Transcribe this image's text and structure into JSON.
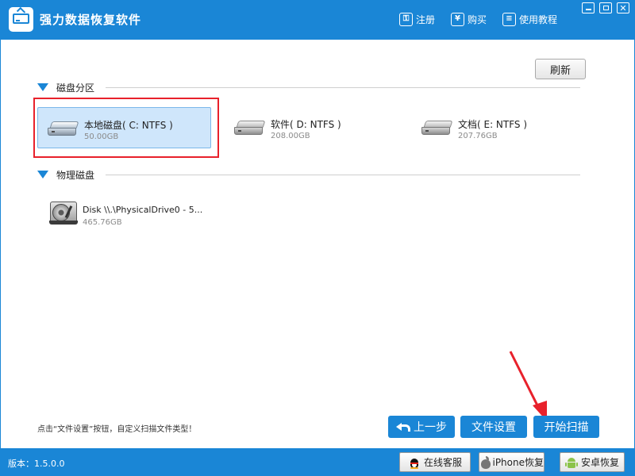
{
  "app": {
    "title": "强力数据恢复软件"
  },
  "header": {
    "register_label": "注册",
    "buy_label": "购买",
    "help_label": "使用教程"
  },
  "toolbar": {
    "refresh_label": "刷新"
  },
  "partitions": {
    "section_label": "磁盘分区",
    "items": [
      {
        "name": "本地磁盘( C: NTFS )",
        "size": "50.00GB",
        "selected": true
      },
      {
        "name": "软件( D: NTFS )",
        "size": "208.00GB",
        "selected": false
      },
      {
        "name": "文档( E: NTFS )",
        "size": "207.76GB",
        "selected": false
      }
    ]
  },
  "physical": {
    "section_label": "物理磁盘",
    "items": [
      {
        "name": "Disk \\\\.\\PhysicalDrive0 - 5...",
        "size": "465.76GB"
      }
    ]
  },
  "hint_text": "点击“文件设置”按钮，自定义扫描文件类型！",
  "actions": {
    "prev_label": "上一步",
    "settings_label": "文件设置",
    "scan_label": "开始扫描"
  },
  "status": {
    "version_text": "版本：1.5.0.0",
    "qq_label": "在线客服",
    "iphone_label": "iPhone恢复",
    "android_label": "安卓恢复"
  },
  "colors": {
    "accent": "#1a86d6",
    "selection_bg": "#cfe6fb",
    "highlight_red": "#e8212b"
  }
}
